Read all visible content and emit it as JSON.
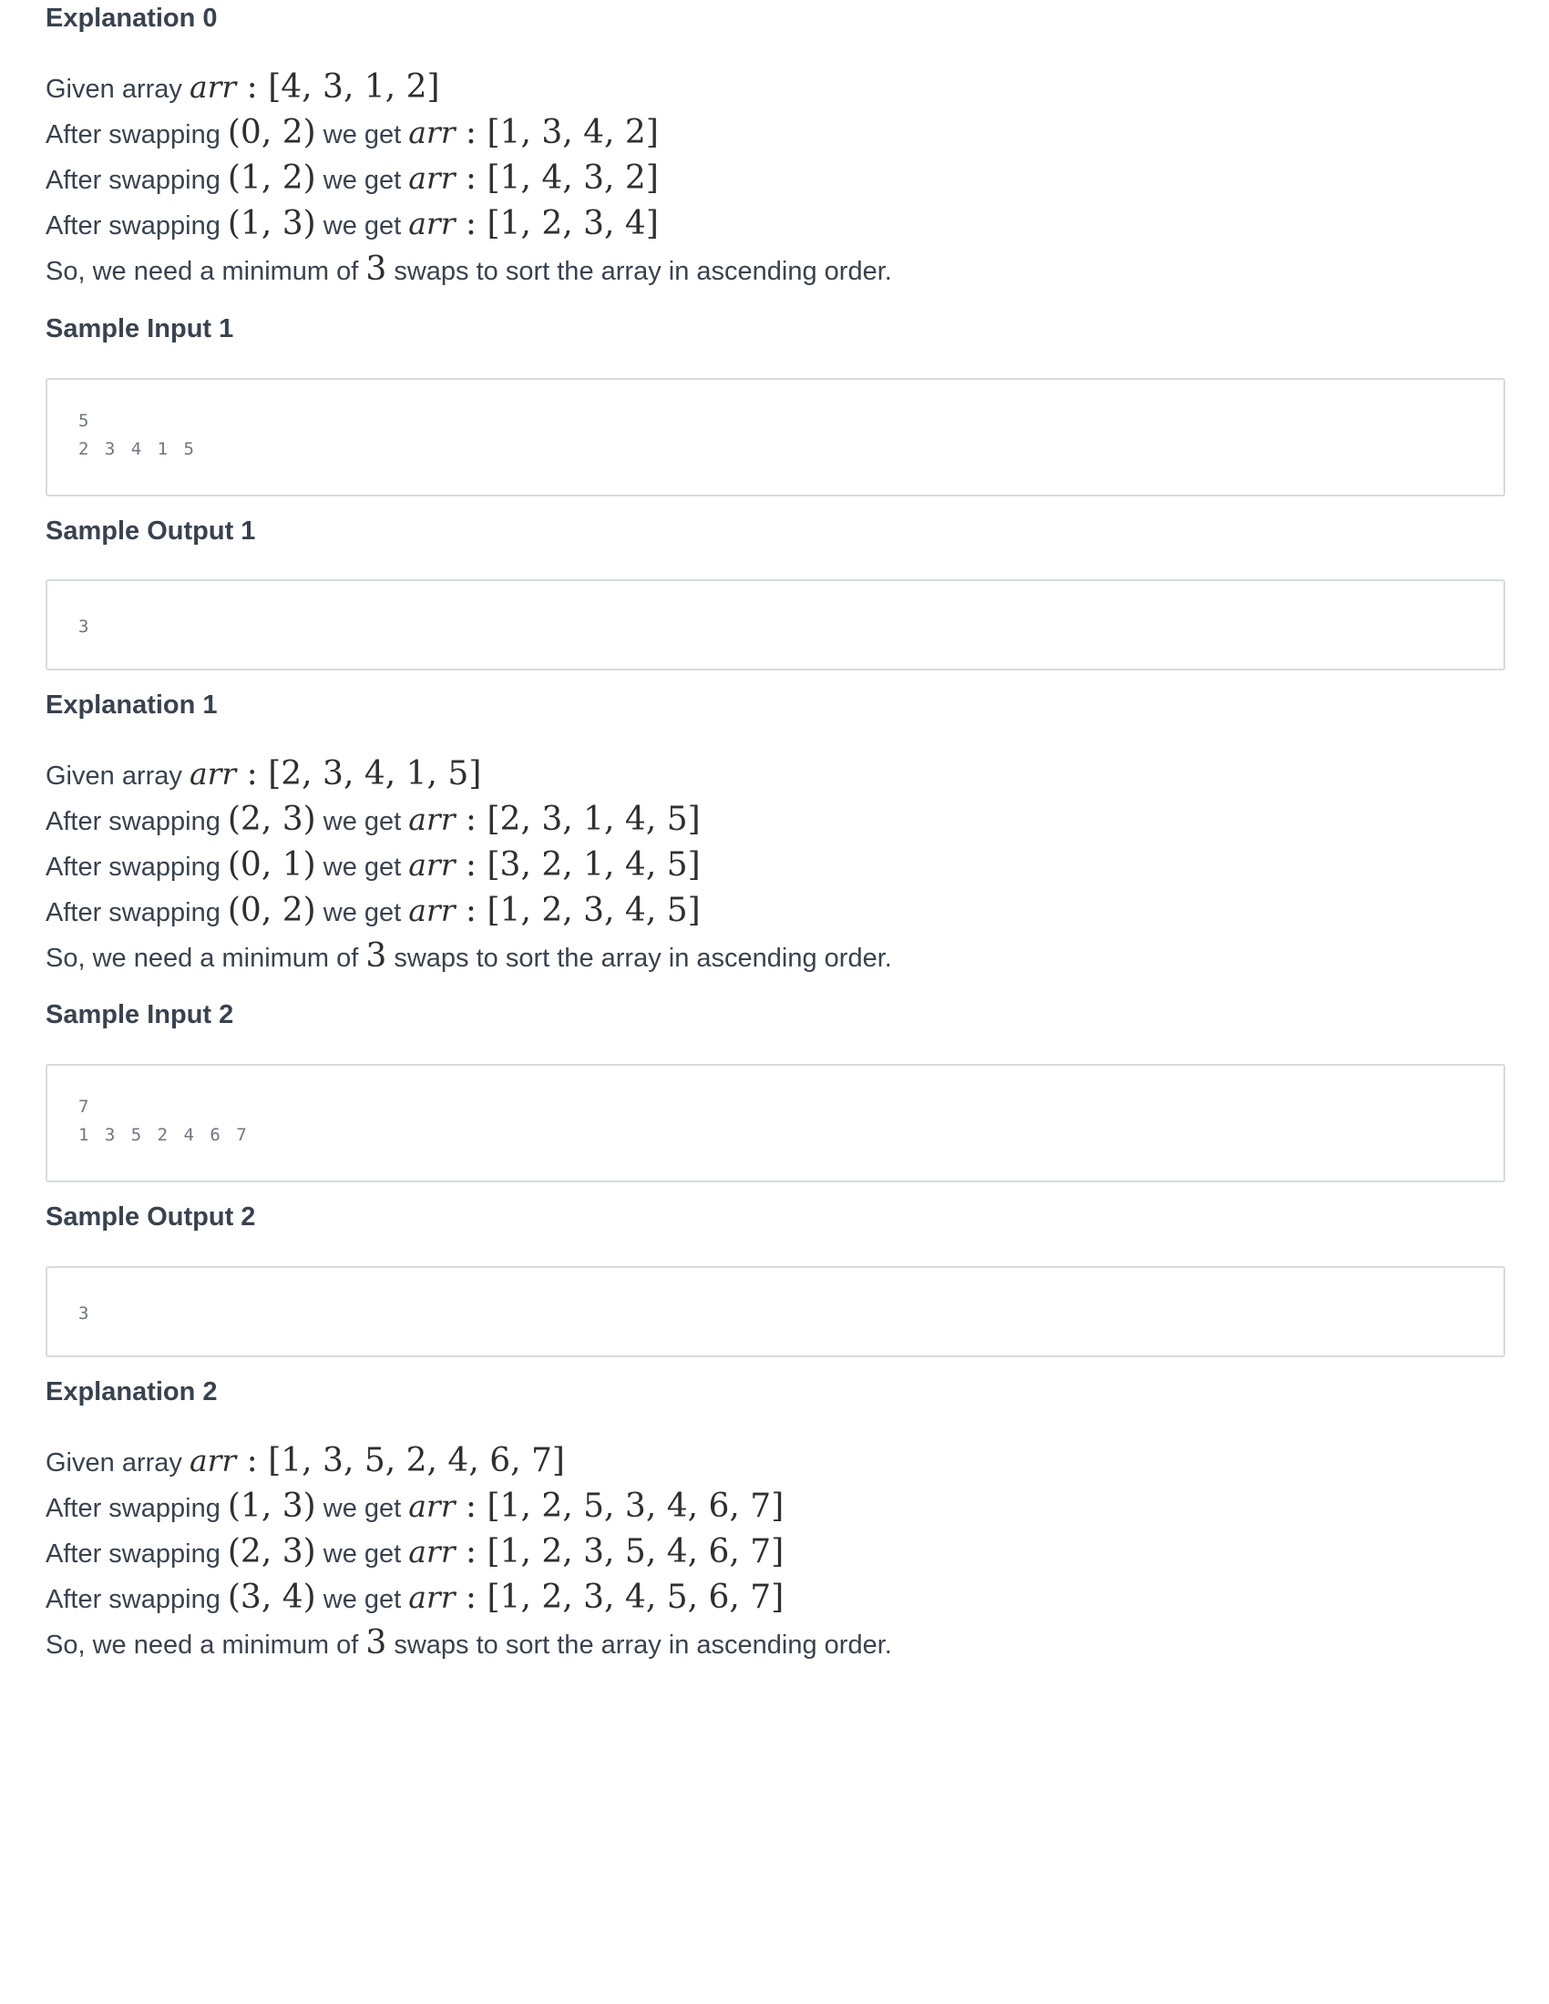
{
  "explanation0": {
    "heading": "Explanation 0",
    "given_prefix": "Given array ",
    "var_name": "arr",
    "colon": " : ",
    "given_array": "[4, 3, 1, 2]",
    "steps": [
      {
        "prefix": "After swapping ",
        "pair": "(0, 2)",
        "middle": " we get ",
        "result": "[1, 3, 4, 2]"
      },
      {
        "prefix": "After swapping ",
        "pair": "(1, 2)",
        "middle": " we get ",
        "result": "[1, 4, 3, 2]"
      },
      {
        "prefix": "After swapping ",
        "pair": "(1, 3)",
        "middle": " we get ",
        "result": "[1, 2, 3, 4]"
      }
    ],
    "summary_prefix": "So, we need a minimum of ",
    "summary_count": "3",
    "summary_suffix": " swaps to sort the array in ascending order."
  },
  "sample_input_1": {
    "heading": "Sample Input 1",
    "lines": [
      "5",
      "2 3 4 1 5"
    ]
  },
  "sample_output_1": {
    "heading": "Sample Output 1",
    "lines": [
      "3"
    ]
  },
  "explanation1": {
    "heading": "Explanation 1",
    "given_prefix": "Given array ",
    "var_name": "arr",
    "colon": " : ",
    "given_array": "[2, 3, 4, 1, 5]",
    "steps": [
      {
        "prefix": "After swapping ",
        "pair": "(2, 3)",
        "middle": " we get ",
        "result": "[2, 3, 1, 4, 5]"
      },
      {
        "prefix": "After swapping ",
        "pair": "(0, 1)",
        "middle": " we get ",
        "result": "[3, 2, 1, 4, 5]"
      },
      {
        "prefix": "After swapping ",
        "pair": "(0, 2)",
        "middle": " we get ",
        "result": "[1, 2, 3, 4, 5]"
      }
    ],
    "summary_prefix": "So, we need a minimum of ",
    "summary_count": "3",
    "summary_suffix": " swaps to sort the array in ascending order."
  },
  "sample_input_2": {
    "heading": "Sample Input 2",
    "lines": [
      "7",
      "1 3 5 2 4 6 7"
    ]
  },
  "sample_output_2": {
    "heading": "Sample Output 2",
    "lines": [
      "3"
    ]
  },
  "explanation2": {
    "heading": "Explanation 2",
    "given_prefix": "Given array ",
    "var_name": "arr",
    "colon": " : ",
    "given_array": "[1, 3, 5, 2, 4, 6, 7]",
    "steps": [
      {
        "prefix": "After swapping ",
        "pair": "(1, 3)",
        "middle": " we get ",
        "result": "[1, 2, 5, 3, 4, 6, 7]"
      },
      {
        "prefix": "After swapping ",
        "pair": "(2, 3)",
        "middle": " we get ",
        "result": "[1, 2, 3, 5, 4, 6, 7]"
      },
      {
        "prefix": "After swapping ",
        "pair": "(3, 4)",
        "middle": " we get ",
        "result": "[1, 2, 3, 4, 5, 6, 7]"
      }
    ],
    "summary_prefix": "So, we need a minimum of ",
    "summary_count": "3",
    "summary_suffix": " swaps to sort the array in ascending order."
  }
}
